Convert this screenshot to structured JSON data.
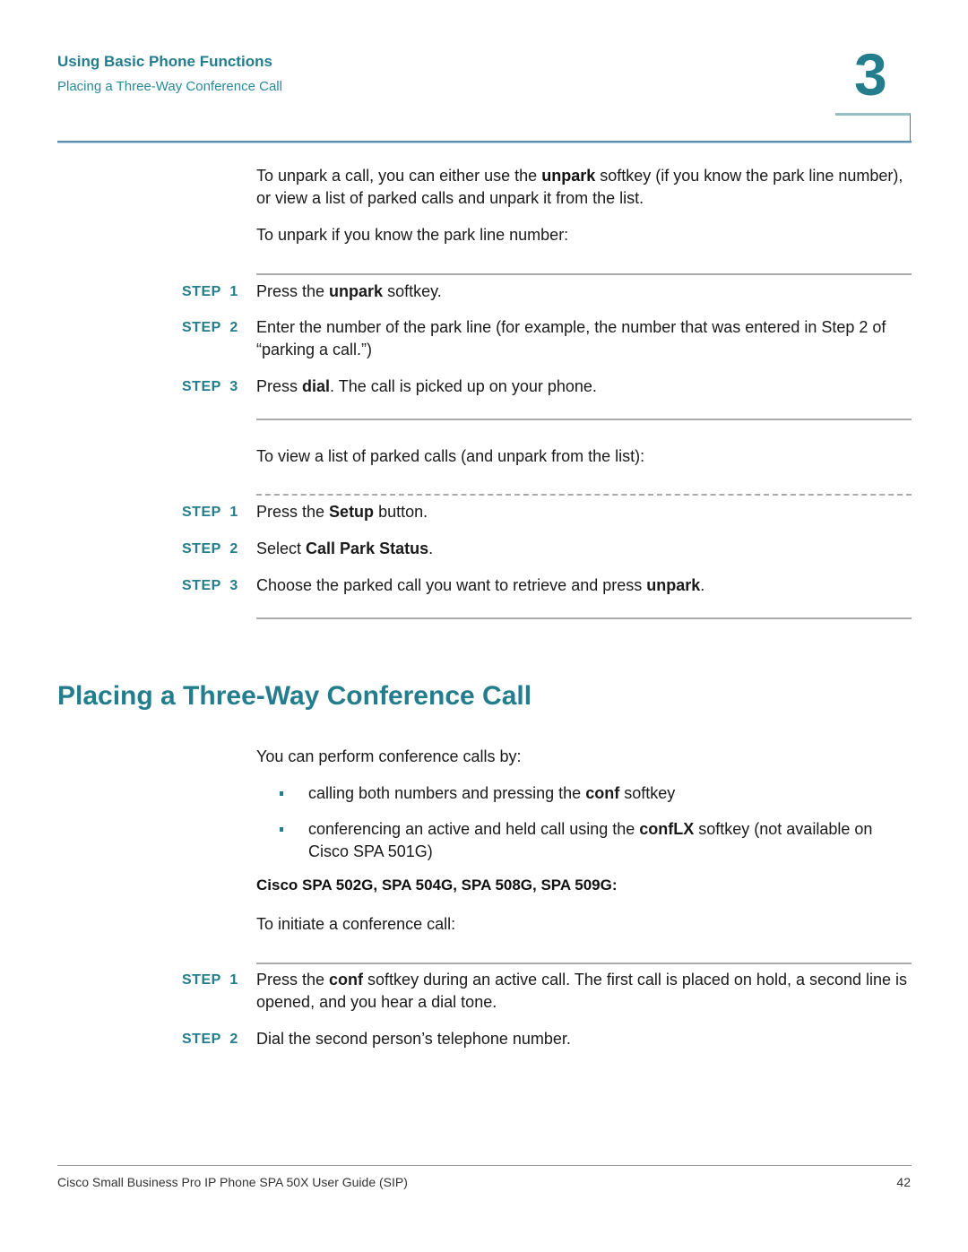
{
  "header": {
    "section": "Using Basic Phone Functions",
    "subsection": "Placing a Three-Way Conference Call",
    "chapter_number": "3"
  },
  "unpark": {
    "intro": {
      "pre": "To unpark a call, you can either use the ",
      "bold": "unpark",
      "post": " softkey (if you know the park line number), or view a list of parked calls and unpark it from the list."
    },
    "known_line_intro": "To unpark if you know the park line number:",
    "known_line_steps": [
      {
        "label": "STEP  1",
        "pre": "Press the ",
        "bold": "unpark",
        "post": " softkey."
      },
      {
        "label": "STEP  2",
        "pre": "Enter the number of the park line (for example, the number that was entered in Step 2 of “parking a call.”)",
        "bold": "",
        "post": ""
      },
      {
        "label": "STEP  3",
        "pre": "Press ",
        "bold": "dial",
        "post": ". The call is picked up on your phone."
      }
    ],
    "list_intro": "To view a list of parked calls (and unpark from the list):",
    "list_steps": [
      {
        "label": "STEP  1",
        "pre": "Press the ",
        "bold": "Setup",
        "post": " button."
      },
      {
        "label": "STEP  2",
        "pre": "Select ",
        "bold": "Call Park Status",
        "post": "."
      },
      {
        "label": "STEP  3",
        "pre": "Choose the parked call you want to retrieve and press ",
        "bold": "unpark",
        "post": "."
      }
    ]
  },
  "conference": {
    "title": "Placing a Three-Way Conference Call",
    "intro": "You can perform conference calls by:",
    "bullets": [
      {
        "pre": "calling both numbers and pressing the ",
        "bold": "conf",
        "post": " softkey"
      },
      {
        "pre": "conferencing an active and held call using the ",
        "bold": "confLX",
        "post": " softkey (not available on Cisco SPA 501G)"
      }
    ],
    "models_heading": "Cisco SPA 502G, SPA 504G, SPA 508G, SPA 509G:",
    "initiate_intro": "To initiate a conference call:",
    "steps": [
      {
        "label": "STEP  1",
        "pre": "Press the ",
        "bold": "conf",
        "post": " softkey during an active call. The first call is placed on hold, a second line is opened, and you hear a dial tone."
      },
      {
        "label": "STEP  2",
        "pre": "Dial the second person’s telephone number.",
        "bold": "",
        "post": ""
      }
    ]
  },
  "footer": {
    "title": "Cisco Small Business Pro IP Phone SPA 50X User Guide (SIP)",
    "page_number": "42"
  }
}
